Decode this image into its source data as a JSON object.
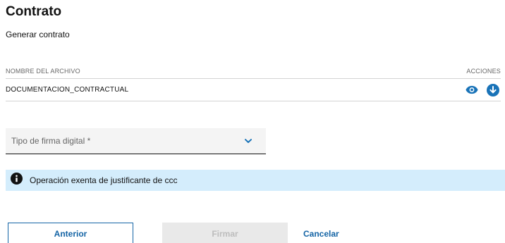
{
  "page": {
    "title": "Contrato",
    "subtitle": "Generar contrato"
  },
  "table": {
    "columns": [
      "NOMBRE DEL ARCHIVO",
      "ACCIONES"
    ],
    "rows": [
      {
        "file_name": "DOCUMENTACION_CONTRACTUAL",
        "actions": [
          "eye-icon",
          "download-icon"
        ]
      }
    ]
  },
  "form": {
    "signature_type_label": "Tipo de firma digital *"
  },
  "info_banner": {
    "icon": "info-icon",
    "text": "Operación exenta de justificante de ccc"
  },
  "buttons": {
    "previous": "Anterior",
    "sign": "Firmar",
    "cancel": "Cancelar"
  },
  "colors": {
    "primary": "#1464a5",
    "accent_blue": "#1973b8",
    "banner_bg": "#d4edfc",
    "disabled_bg": "#e9e9e9",
    "disabled_text": "#bdbdbd"
  }
}
